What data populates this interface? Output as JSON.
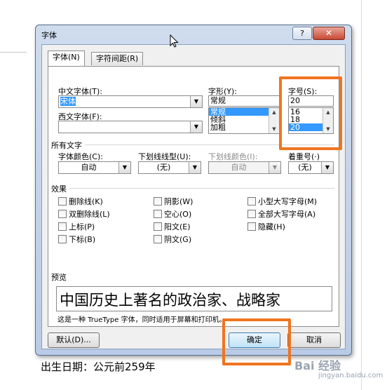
{
  "background": {
    "text": "出生日期：公元前259年",
    "watermark": "Bai 经验",
    "watermark_sub": "jingyan.baidu.com"
  },
  "dialog": {
    "title": "字体",
    "help_button": "?",
    "close_button": "✕",
    "tabs": [
      {
        "label": "字体(N)"
      },
      {
        "label": "字符间距(R)"
      }
    ],
    "chinese_font": {
      "label": "中文字体(T):",
      "value": "宋体"
    },
    "western_font": {
      "label": "西文字体(F):",
      "value": ""
    },
    "style": {
      "label": "字形(Y):",
      "value": "常规",
      "options": [
        "常规",
        "倾斜",
        "加粗"
      ]
    },
    "size": {
      "label": "字号(S):",
      "value": "20",
      "options": [
        "16",
        "18",
        "20"
      ]
    },
    "all_text": {
      "section": "所有文字",
      "font_color": {
        "label": "字体颜色(C):",
        "value": "自动"
      },
      "underline_style": {
        "label": "下划线线型(U):",
        "value": "(无)"
      },
      "underline_color": {
        "label": "下划线颜色(I):",
        "value": "自动"
      },
      "emphasis": {
        "label": "着重号(·)",
        "value": "(无)"
      }
    },
    "effects": {
      "section": "效果",
      "col1": [
        "删除线(K)",
        "双删除线(L)",
        "上标(P)",
        "下标(B)"
      ],
      "col2": [
        "阴影(W)",
        "空心(O)",
        "阳文(E)",
        "阴文(G)"
      ],
      "col3": [
        "小型大写字母(M)",
        "全部大写字母(A)",
        "隐藏(H)"
      ]
    },
    "preview": {
      "section": "预览",
      "text": "中国历史上著名的政治家、战略家",
      "note": "这是一种 TrueType 字体，同时适用于屏幕和打印机。"
    },
    "buttons": {
      "default": "默认(D)...",
      "ok": "确定",
      "cancel": "取消"
    }
  }
}
